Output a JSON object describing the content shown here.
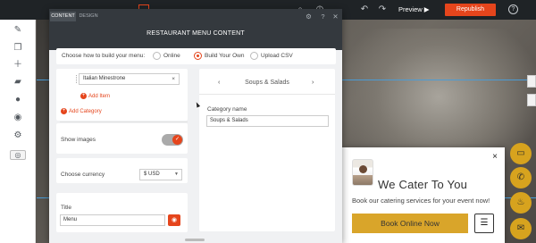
{
  "topbar": {
    "preview_label": "Preview",
    "republish_label": "Republish",
    "help_label": "?"
  },
  "sidebar": {
    "icons": [
      "brush-icon",
      "pages-icon",
      "add-icon",
      "folder-icon",
      "user-icon",
      "chat-icon",
      "gear-icon",
      "eye-icon"
    ]
  },
  "panel": {
    "tabs": [
      {
        "label": "CONTENT",
        "active": true
      },
      {
        "label": "DESIGN",
        "active": false
      }
    ],
    "title": "RESTAURANT MENU CONTENT",
    "build": {
      "label": "Choose how to build your menu:",
      "options": [
        {
          "label": "Online",
          "selected": false
        },
        {
          "label": "Build Your Own",
          "selected": true
        },
        {
          "label": "Upload CSV",
          "selected": false
        }
      ]
    },
    "items": {
      "item_value": "Italian Minestrone",
      "add_item_label": "Add Item",
      "add_category_label": "Add Category"
    },
    "show_images": {
      "label": "Show images",
      "on": true
    },
    "currency": {
      "label": "Choose currency",
      "value": "$ USD"
    },
    "title_field": {
      "label": "Title",
      "value": "Menu"
    },
    "category": {
      "current": "Soups & Salads",
      "field_label": "Category name",
      "field_value": "Soups & Salads"
    }
  },
  "popup": {
    "title": "We Cater To You",
    "subtitle": "Book our catering services for your event now!",
    "cta_label": "Book Online Now",
    "close_label": "×",
    "menu_label": "☰"
  },
  "fabs": [
    "credit-card-icon",
    "phone-icon",
    "chef-hat-icon",
    "mail-icon"
  ],
  "colors": {
    "accent": "#e5451c",
    "gold": "#d9a52a",
    "dark_header": "#34393e"
  }
}
